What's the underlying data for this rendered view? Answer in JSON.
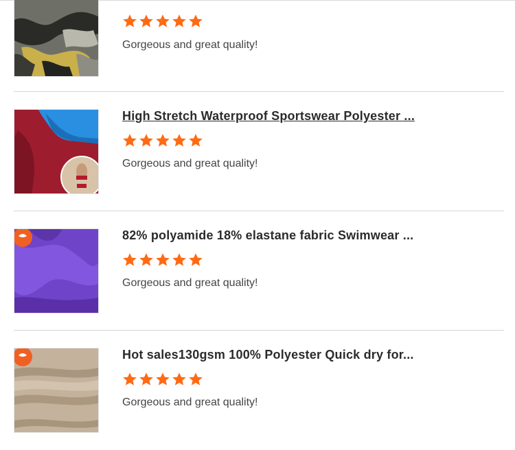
{
  "reviews": [
    {
      "title": "",
      "rating": 5,
      "comment": "Gorgeous and great quality!",
      "image_icon": "camo-fabric-image"
    },
    {
      "title": "High Stretch Waterproof Sportswear Polyester ...",
      "rating": 5,
      "comment": "Gorgeous and great quality!",
      "image_icon": "swimwear-fabric-image"
    },
    {
      "title": "82% polyamide 18% elastane fabric Swimwear ...",
      "rating": 5,
      "comment": "Gorgeous and great quality!",
      "image_icon": "purple-fabric-image"
    },
    {
      "title": "Hot sales130gsm 100% Polyester Quick dry for...",
      "rating": 5,
      "comment": "Gorgeous and great quality!",
      "image_icon": "beige-fabric-image"
    }
  ],
  "colors": {
    "star": "#ff6a13",
    "separator": "#d6d6d6"
  }
}
